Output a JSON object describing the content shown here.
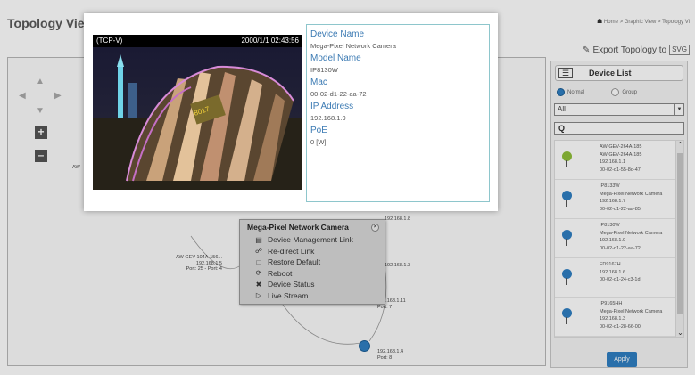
{
  "page": {
    "title": "Topology Viev",
    "breadcrumb": [
      "Home",
      "Graphic View",
      "Topology Vi"
    ],
    "export_label": "Export Topology to",
    "export_format": "SVG"
  },
  "canvas": {
    "nodes": [
      {
        "label": "AW-GEV-104A-156...\n192.168.1.5\nPort: 25 - Port: 4"
      },
      {
        "label": "192.168.1.8"
      },
      {
        "label": "192.168.1.3"
      },
      {
        "label": "192.168.1.11\nPort: 7"
      },
      {
        "label": "192.168.1.4\nPort: 8"
      }
    ],
    "left_node_label": "AW"
  },
  "context_menu": {
    "title": "Mega-Pixel Network Camera",
    "items": [
      {
        "label": "Device Management Link",
        "icon": "monitor-icon"
      },
      {
        "label": "Re-direct Link",
        "icon": "link-icon"
      },
      {
        "label": "Restore Default",
        "icon": "restore-icon"
      },
      {
        "label": "Reboot",
        "icon": "reboot-icon"
      },
      {
        "label": "Device Status",
        "icon": "tools-icon"
      },
      {
        "label": "Live Stream",
        "icon": "stream-icon"
      }
    ]
  },
  "device_panel": {
    "title": "Device List",
    "radio_normal": "Normal",
    "radio_group": "Group",
    "filter_value": "All",
    "search_glyph": "Q",
    "devices": [
      {
        "lines": [
          "AW-GEV-264A-185",
          "AW-GEV-264A-185",
          "192.168.1.1",
          "00-02-d1-55-8d-47"
        ],
        "color": "green"
      },
      {
        "lines": [
          "IP8133W",
          "Mega-Pixel Network Camera",
          "192.168.1.7",
          "00-02-d1-22-aa-85"
        ],
        "color": "blue"
      },
      {
        "lines": [
          "IP8130W",
          "Mega-Pixel Network Camera",
          "192.168.1.9",
          "00-02-d1-22-aa-72"
        ],
        "color": "blue"
      },
      {
        "lines": [
          "FD9167H",
          "",
          "192.168.1.6",
          "00-02-d1-24-c3-1d"
        ],
        "color": "blue"
      },
      {
        "lines": [
          "IP9165HH",
          "Mega-Pixel Network Camera",
          "192.168.1.3",
          "00-02-d1-28-66-00"
        ],
        "color": "blue"
      }
    ],
    "apply_label": "Apply"
  },
  "popup": {
    "video_label": "(TCP-V)",
    "video_timestamp": "2000/1/1 02:43:56",
    "fields": [
      {
        "label": "Device Name",
        "value": "Mega-Pixel Network Camera"
      },
      {
        "label": "Model Name",
        "value": "IP8130W"
      },
      {
        "label": "Mac",
        "value": "00-02-d1-22-aa-72"
      },
      {
        "label": "IP Address",
        "value": "192.168.1.9"
      },
      {
        "label": "PoE",
        "value": "0 [W]"
      }
    ]
  },
  "colors": {
    "accent": "#2f7fc2",
    "label_blue": "#3b7ab3",
    "info_border": "#8ec6cc"
  }
}
